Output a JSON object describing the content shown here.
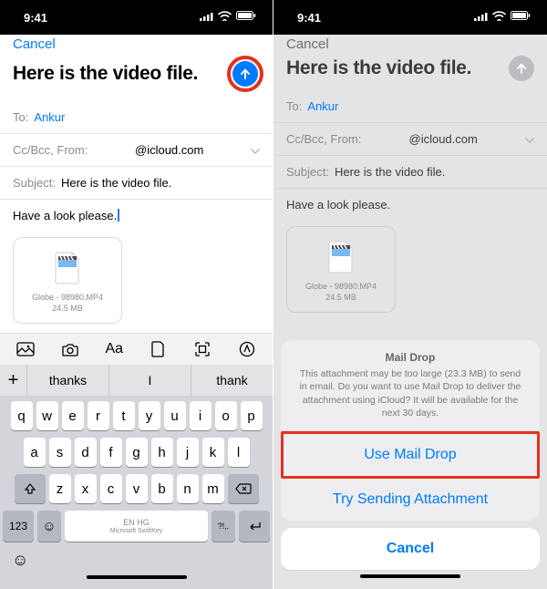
{
  "status": {
    "time": "9:41"
  },
  "compose": {
    "cancel": "Cancel",
    "title": "Here is the video file.",
    "to_label": "To:",
    "to_value": "Ankur",
    "ccbcc_label": "Cc/Bcc, From:",
    "from_value": "@icloud.com",
    "subject_label": "Subject:",
    "subject_value": "Here is the video file.",
    "body": "Have a look please.",
    "attachment": {
      "name": "Globe - 98980.MP4",
      "size": "24.5 MB"
    }
  },
  "keyboard": {
    "suggestions": [
      "thanks",
      "I",
      "thank"
    ],
    "rows": [
      [
        "q",
        "w",
        "e",
        "r",
        "t",
        "y",
        "u",
        "i",
        "o",
        "p"
      ],
      [
        "a",
        "s",
        "d",
        "f",
        "g",
        "h",
        "j",
        "k",
        "l"
      ],
      [
        "z",
        "x",
        "c",
        "v",
        "b",
        "n",
        "m"
      ]
    ],
    "numKey": "123",
    "spaceTop": "EN HG",
    "spaceSub": "Microsoft SwiftKey",
    "punct": "?!,."
  },
  "sheet": {
    "title": "Mail Drop",
    "description": "This attachment may be too large (23.3 MB) to send in email. Do you want to use Mail Drop to deliver the attachment using iCloud? It will be available for the next 30 days.",
    "primary": "Use Mail Drop",
    "secondary": "Try Sending Attachment",
    "cancel": "Cancel"
  }
}
